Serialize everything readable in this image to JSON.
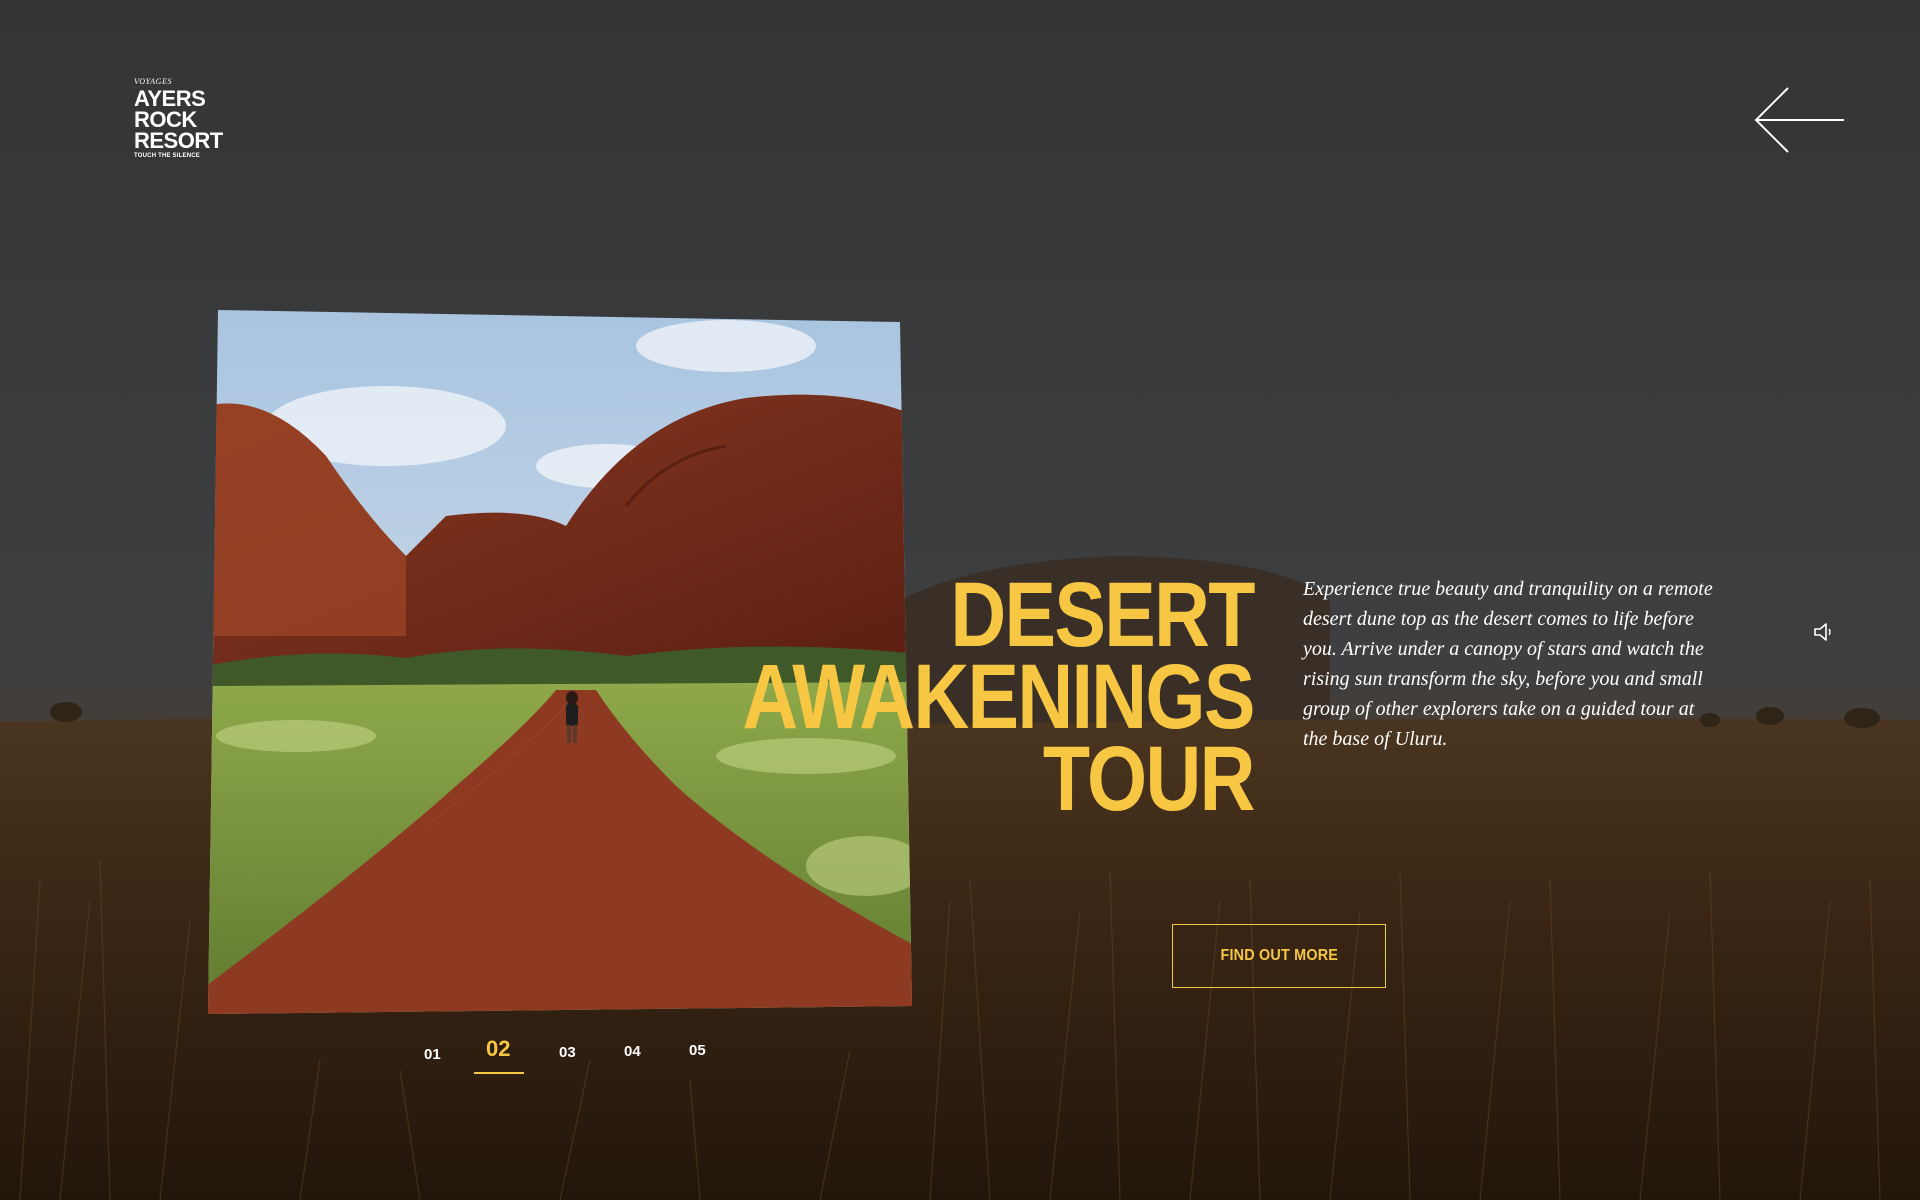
{
  "brand": {
    "pre": "VOYAGES",
    "lines": [
      "AYERS",
      "ROCK",
      "RESORT"
    ],
    "tagline": "TOUCH THE SILENCE"
  },
  "hero": {
    "title_lines": [
      "DESERT",
      "AWAKENINGS",
      "TOUR"
    ],
    "description": "Experience true beauty and tranquility on a remote desert dune top as the desert comes to life before you. Arrive under a canopy of stars and watch the rising sun transform the sky, before you and small group of other explorers take on a guided tour at the base of Uluru.",
    "cta_label": "FIND OUT MORE"
  },
  "pagination": {
    "pages": [
      "01",
      "02",
      "03",
      "04",
      "05"
    ],
    "active": "02"
  },
  "icons": {
    "back": "arrow-left-icon",
    "sound": "speaker-icon"
  },
  "colors": {
    "accent": "#f7c744",
    "sky": "#38393b",
    "text": "#ffffff"
  }
}
